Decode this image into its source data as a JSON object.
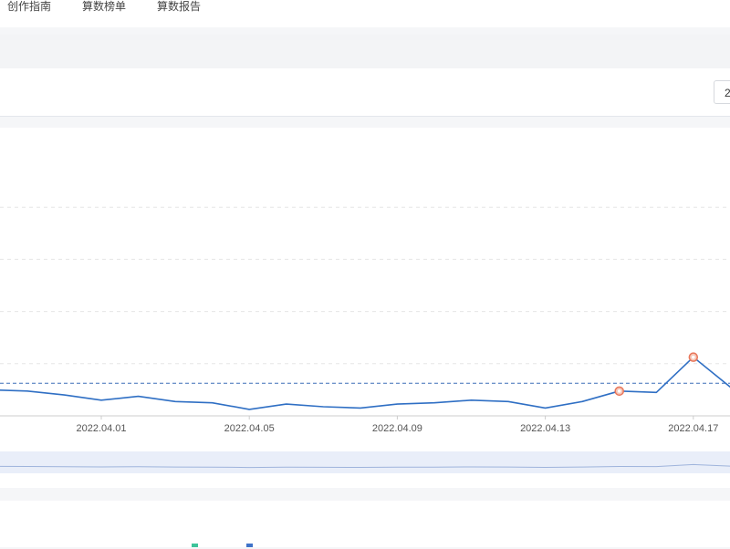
{
  "nav": {
    "items": [
      {
        "label": "创作指南"
      },
      {
        "label": "算数榜单"
      },
      {
        "label": "算数报告"
      }
    ]
  },
  "toolbar": {
    "date_value": "2"
  },
  "chart_data": {
    "type": "line",
    "title": "",
    "x_tick_labels": [
      "2022.04.01",
      "2022.04.05",
      "2022.04.09",
      "2022.04.13",
      "2022.04.17"
    ],
    "x": [
      "2022.03.29",
      "2022.03.30",
      "2022.03.31",
      "2022.04.01",
      "2022.04.02",
      "2022.04.03",
      "2022.04.04",
      "2022.04.05",
      "2022.04.06",
      "2022.04.07",
      "2022.04.08",
      "2022.04.09",
      "2022.04.10",
      "2022.04.11",
      "2022.04.12",
      "2022.04.13",
      "2022.04.14",
      "2022.04.15",
      "2022.04.16",
      "2022.04.17",
      "2022.04.18"
    ],
    "series": [
      {
        "color": "#2f6fc4",
        "values": [
          2.0,
          1.9,
          1.6,
          1.2,
          1.5,
          1.1,
          1.0,
          0.5,
          0.9,
          0.7,
          0.6,
          0.9,
          1.0,
          1.2,
          1.1,
          0.6,
          1.1,
          1.9,
          1.8,
          4.5,
          2.2
        ]
      }
    ],
    "highlight_points": [
      17,
      19
    ],
    "reference_line": 2.5,
    "ylim": [
      0,
      20
    ],
    "grid": true,
    "brush": true
  },
  "colors": {
    "line": "#2f6fc4",
    "marker": "#e8765a",
    "legend_a": "#3cc49a",
    "legend_b": "#3f73c9"
  }
}
